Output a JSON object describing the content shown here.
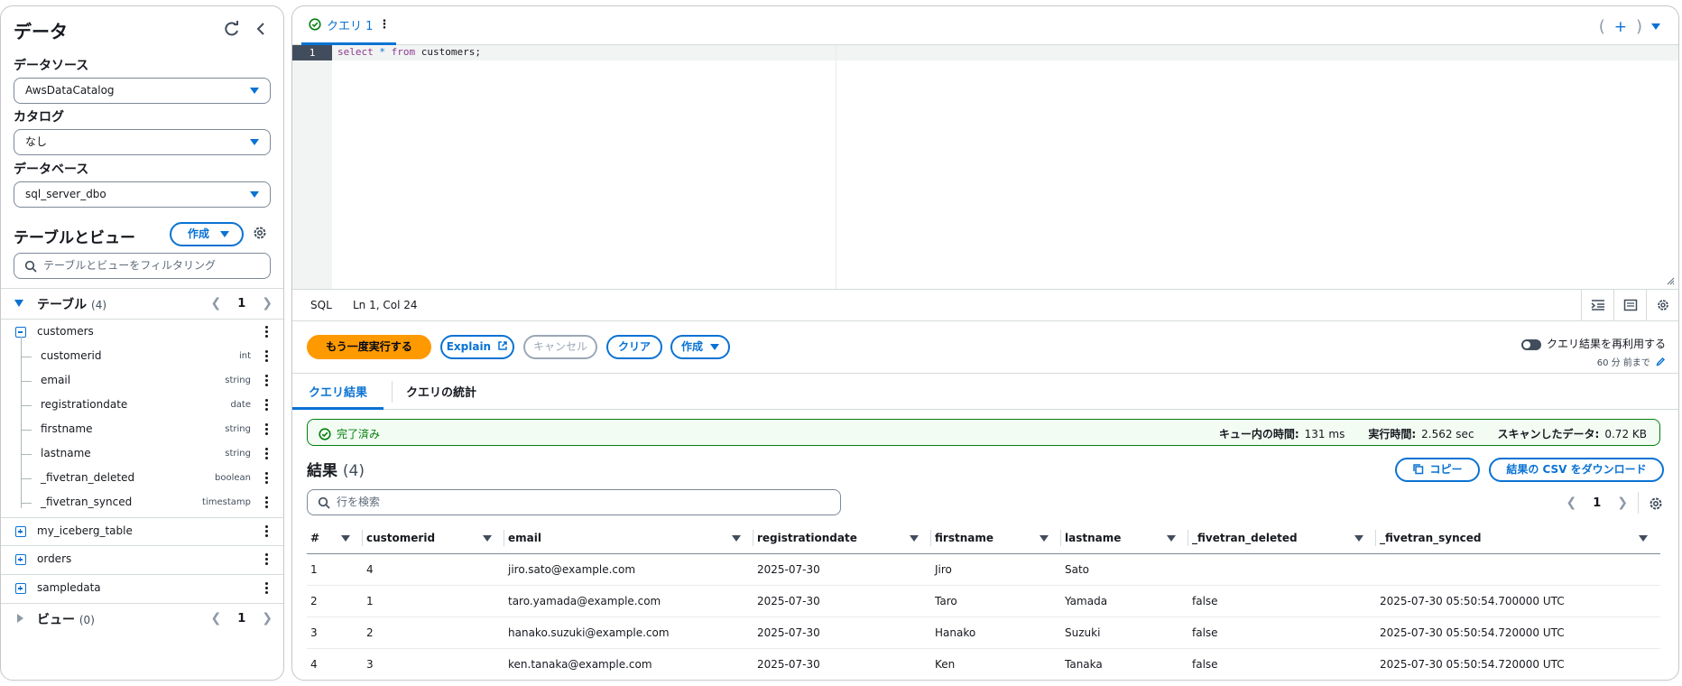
{
  "sidebar": {
    "title": "データ",
    "datasource_label": "データソース",
    "datasource_value": "AwsDataCatalog",
    "catalog_label": "カタログ",
    "catalog_value": "なし",
    "database_label": "データベース",
    "database_value": "sql_server_dbo",
    "tables_views_title": "テーブルとビュー",
    "create_label": "作成",
    "filter_placeholder": "テーブルとビューをフィルタリング",
    "tables_section": {
      "label": "テーブル",
      "count": "(4)",
      "page": "1"
    },
    "views_section": {
      "label": "ビュー",
      "count": "(0)",
      "page": "1"
    },
    "expanded_table": "customers",
    "columns": [
      {
        "name": "customerid",
        "type": "int"
      },
      {
        "name": "email",
        "type": "string"
      },
      {
        "name": "registrationdate",
        "type": "date"
      },
      {
        "name": "firstname",
        "type": "string"
      },
      {
        "name": "lastname",
        "type": "string"
      },
      {
        "name": "_fivetran_deleted",
        "type": "boolean"
      },
      {
        "name": "_fivetran_synced",
        "type": "timestamp"
      }
    ],
    "other_tables": [
      "my_iceberg_table",
      "orders",
      "sampledata"
    ]
  },
  "editor": {
    "tab_label": "クエリ 1",
    "line_number": "1",
    "code": {
      "k1": "select",
      "op": "*",
      "k2": "from",
      "rest": "customers;"
    },
    "language": "SQL",
    "cursor": "Ln 1, Col 24"
  },
  "actions": {
    "run_again": "もう一度実行する",
    "explain": "Explain",
    "cancel": "キャンセル",
    "clear": "クリア",
    "create": "作成",
    "reuse_label": "クエリ結果を再利用する",
    "reuse_sub": "60 分 前まで"
  },
  "results_tabs": {
    "results": "クエリ結果",
    "stats": "クエリの統計"
  },
  "status": {
    "done": "完了済み",
    "queue_label": "キュー内の時間:",
    "queue_value": "131 ms",
    "exec_label": "実行時間:",
    "exec_value": "2.562 sec",
    "scan_label": "スキャンしたデータ:",
    "scan_value": "0.72 KB"
  },
  "results": {
    "title": "結果",
    "count": "(4)",
    "copy": "コピー",
    "download": "結果の CSV をダウンロード",
    "search_placeholder": "行を検索",
    "page": "1",
    "columns": [
      "#",
      "customerid",
      "email",
      "registrationdate",
      "firstname",
      "lastname",
      "_fivetran_deleted",
      "_fivetran_synced"
    ],
    "rows": [
      [
        "1",
        "4",
        "jiro.sato@example.com",
        "2025-07-30",
        "Jiro",
        "Sato",
        "",
        ""
      ],
      [
        "2",
        "1",
        "taro.yamada@example.com",
        "2025-07-30",
        "Taro",
        "Yamada",
        "false",
        "2025-07-30 05:50:54.700000 UTC"
      ],
      [
        "3",
        "2",
        "hanako.suzuki@example.com",
        "2025-07-30",
        "Hanako",
        "Suzuki",
        "false",
        "2025-07-30 05:50:54.720000 UTC"
      ],
      [
        "4",
        "3",
        "ken.tanaka@example.com",
        "2025-07-30",
        "Ken",
        "Tanaka",
        "false",
        "2025-07-30 05:50:54.720000 UTC"
      ]
    ]
  },
  "colors": {
    "accent": "#0972d3",
    "primary_button": "#ff9900",
    "success": "#037f0c"
  },
  "icons": [
    "refresh-icon",
    "collapse-icon",
    "gear-icon",
    "search-icon",
    "external-link-icon",
    "copy-icon",
    "edit-icon",
    "check-circle-icon",
    "add-icon",
    "kebab-icon"
  ]
}
